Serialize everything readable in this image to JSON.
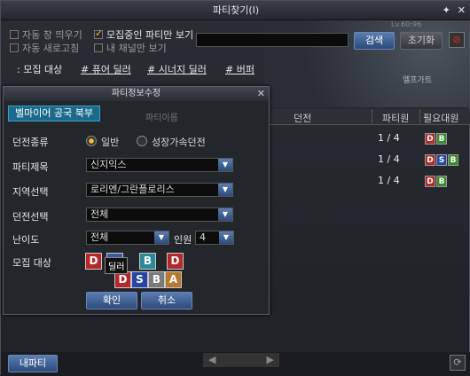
{
  "window": {
    "title": "파티찾기(I)",
    "pin_icon": "pin-icon",
    "close_icon": "close-icon"
  },
  "options": {
    "auto_popup": "자동 창 띄우기",
    "only_joinable": "모집중인 파티만 보기",
    "auto_refresh": "자동 새로고침",
    "my_channel": "내 채널만 보기"
  },
  "search": {
    "button": "검색",
    "reset": "초기화"
  },
  "categories": [
    "모집 대상",
    "# 퓨어 딜러",
    "# 시너지 딜러",
    "# 버퍼"
  ],
  "table": {
    "headers": {
      "dungeon": "던전",
      "members": "파티원",
      "required": "필요대원"
    },
    "rows": [
      {
        "members": "1 / 4",
        "badges": [
          "D",
          "B"
        ]
      },
      {
        "members": "1 / 4",
        "badges": [
          "D",
          "S",
          "B"
        ]
      },
      {
        "members": "1 / 4",
        "badges": [
          "D",
          "B"
        ]
      }
    ]
  },
  "dialog": {
    "title": "파티정보수정",
    "zone": "벨마이어 공국 북부",
    "party_name_header": "파티이름",
    "labels": {
      "dungeon_type": "던전종류",
      "party_title": "파티제목",
      "region": "지역선택",
      "dungeon": "던전선택",
      "difficulty": "난이도",
      "members": "인원",
      "recruit": "모집 대상"
    },
    "dungeon_type_options": {
      "normal": "일반",
      "growth": "성장가속던전"
    },
    "party_title_value": "신지익스",
    "region_value": "로리엔/그란플로리스",
    "dungeon_value": "전체",
    "difficulty_value": "전체",
    "members_value": "4",
    "tooltip": "딜러",
    "confirm": "확인",
    "cancel": "취소"
  },
  "footer": {
    "my_party": "내파티",
    "version": "Lv.60:96",
    "map_label": "엘프가트"
  }
}
